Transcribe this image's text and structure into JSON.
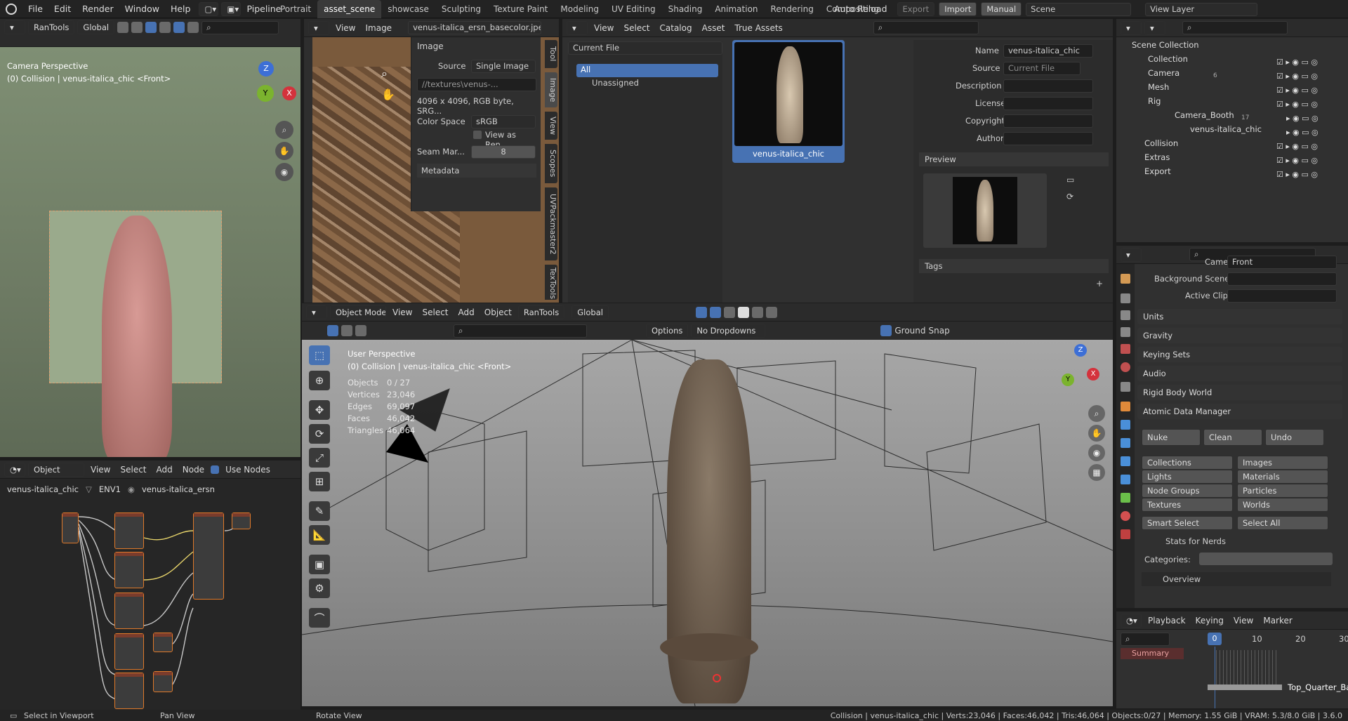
{
  "app": {
    "top_menu": [
      "File",
      "Edit",
      "Render",
      "Window",
      "Help"
    ],
    "pipeline": "Pipeline",
    "workspaces": [
      "Portrait",
      "asset_scene",
      "showcase",
      "Sculpting",
      "Texture Paint",
      "Modeling",
      "UV Editing",
      "Shading",
      "Animation",
      "Rendering",
      "Compositing"
    ],
    "active_workspace": "asset_scene",
    "auto_reload": "Auto Reload",
    "export": "Export",
    "import": "Import",
    "manual": "Manual",
    "scene": "Scene",
    "view_layer": "View Layer"
  },
  "cam_view": {
    "toolbar": {
      "rantools": "RanTools",
      "orient": "Global"
    },
    "title": "Camera Perspective",
    "subtitle": "(0) Collision | venus-italica_chic <Front>"
  },
  "image_editor": {
    "menu": [
      "View",
      "Image"
    ],
    "image_name": "venus-italica_ersn_basecolor.jpeg",
    "panel_title": "Image",
    "source_label": "Source",
    "source_value": "Single Image",
    "path": "//textures\\venus-...",
    "info": "4096 x 4096,  RGB byte,  SRG...",
    "colorspace_label": "Color Space",
    "colorspace_value": "sRGB",
    "view_as_render": "View as Ren...",
    "seam_label": "Seam Mar...",
    "seam_value": "8",
    "metadata": "Metadata",
    "vtabs": [
      "Tool",
      "Image",
      "View",
      "Scopes",
      "UVPackmaster2",
      "TexTools"
    ]
  },
  "asset_browser": {
    "menu": [
      "View",
      "Select",
      "Catalog",
      "Asset",
      "True Assets"
    ],
    "library": "Current File",
    "catalogs": [
      "All",
      "Unassigned"
    ],
    "asset_name": "venus-italica_chic",
    "props": {
      "name_label": "Name",
      "name_value": "venus-italica_chic",
      "source_label": "Source",
      "source_value": "Current File",
      "description_label": "Description",
      "license_label": "License",
      "copyright_label": "Copyright",
      "author_label": "Author"
    },
    "preview_title": "Preview",
    "tags_title": "Tags"
  },
  "outliner": {
    "root": "Scene Collection",
    "items": [
      {
        "label": "Collection",
        "badge": ""
      },
      {
        "label": "Camera",
        "badge": "6"
      },
      {
        "label": "Mesh",
        "badge": ""
      },
      {
        "label": "Rig",
        "badge": ""
      },
      {
        "label": "Camera_Booth",
        "badge": "17"
      },
      {
        "label": "venus-italica_chic",
        "badge": ""
      },
      {
        "label": "Collision",
        "badge": ""
      },
      {
        "label": "Extras",
        "badge": ""
      },
      {
        "label": "Export",
        "badge": ""
      }
    ]
  },
  "properties": {
    "camera_label": "Camera",
    "camera_value": "Front",
    "bg_scene_label": "Background Scene",
    "active_clip_label": "Active Clip",
    "sections": [
      "Units",
      "Gravity",
      "Keying Sets",
      "Audio",
      "Rigid Body World",
      "Atomic Data Manager"
    ],
    "atomic": {
      "nuke": "Nuke",
      "clean": "Clean",
      "undo": "Undo",
      "left": [
        "Collections",
        "Lights",
        "Node Groups",
        "Textures"
      ],
      "right": [
        "Images",
        "Materials",
        "Particles",
        "Worlds"
      ],
      "smart_select": "Smart Select",
      "select_all": "Select All",
      "stats": "Stats for Nerds",
      "categories": "Categories:",
      "overview": "Overview"
    }
  },
  "viewport": {
    "mode": "Object Mode",
    "menu": [
      "View",
      "Select",
      "Add",
      "Object"
    ],
    "rantools": "RanTools",
    "orient": "Global",
    "options": "Options",
    "dropdowns": "No Dropdowns",
    "ground": "Ground",
    "snap": "Snap",
    "title": "User Perspective",
    "subtitle": "(0) Collision | venus-italica_chic <Front>",
    "stats": [
      {
        "k": "Objects",
        "v": "0 / 27"
      },
      {
        "k": "Vertices",
        "v": "23,046"
      },
      {
        "k": "Edges",
        "v": "69,097"
      },
      {
        "k": "Faces",
        "v": "46,042"
      },
      {
        "k": "Triangles",
        "v": "46,064"
      }
    ]
  },
  "node_editor": {
    "mode": "Object",
    "menu": [
      "View",
      "Select",
      "Add",
      "Node"
    ],
    "use_nodes": "Use Nodes",
    "crumbs": [
      "venus-italica_chic",
      "ENV1",
      "venus-italica_ersn"
    ]
  },
  "timeline": {
    "menu": [
      "Playback",
      "Keying",
      "View",
      "Marker"
    ],
    "frame": "0",
    "ticks": [
      "10",
      "20",
      "30"
    ],
    "summary": "Summary",
    "track": "Top_Quarter_Bac"
  },
  "status": {
    "left": "Select in Viewport",
    "mid": "Pan View",
    "rot": "Rotate View",
    "right": "Collision | venus-italica_chic | Verts:23,046 | Faces:46,042 | Tris:46,064 | Objects:0/27 | Memory: 1.55 GiB | VRAM: 5.3/8.0 GiB | 3.6.0"
  }
}
